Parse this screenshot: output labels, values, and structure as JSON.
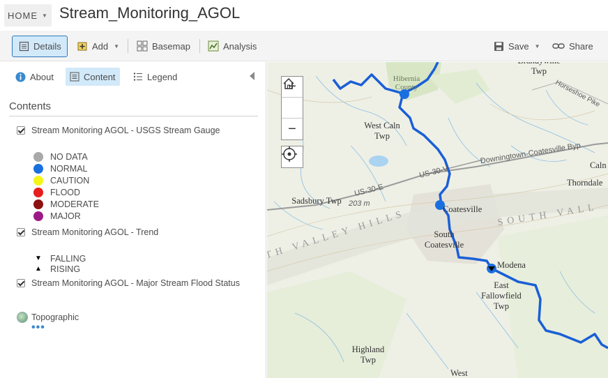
{
  "header": {
    "home_label": "HOME",
    "map_title": "Stream_Monitoring_AGOL"
  },
  "toolbar": {
    "details_label": "Details",
    "add_label": "Add",
    "basemap_label": "Basemap",
    "analysis_label": "Analysis",
    "save_label": "Save",
    "share_label": "Share"
  },
  "panel": {
    "tabs": [
      {
        "label": "About",
        "icon": "info-icon",
        "active": false
      },
      {
        "label": "Content",
        "icon": "content-icon",
        "active": true
      },
      {
        "label": "Legend",
        "icon": "legend-icon",
        "active": false
      }
    ],
    "contents_heading": "Contents",
    "layers": [
      {
        "label": "Stream Monitoring AGOL - USGS Stream Gauge",
        "checked": true
      },
      {
        "label": "Stream Monitoring AGOL - Trend",
        "checked": true
      },
      {
        "label": "Stream Monitoring AGOL - Major Stream Flood Status",
        "checked": true
      }
    ],
    "gauge_legend": [
      {
        "label": "NO DATA",
        "color": "#a9a9a9"
      },
      {
        "label": "NORMAL",
        "color": "#1a6fe0"
      },
      {
        "label": "CAUTION",
        "color": "#f5f51a"
      },
      {
        "label": "FLOOD",
        "color": "#e81d1d"
      },
      {
        "label": "MODERATE",
        "color": "#8c1212"
      },
      {
        "label": "MAJOR",
        "color": "#9c1a86"
      }
    ],
    "trend_legend": [
      {
        "label": "FALLING",
        "symbol": "▼"
      },
      {
        "label": "RISING",
        "symbol": "▲"
      }
    ],
    "basemap_label": "Topographic",
    "ellipsis": "•••"
  },
  "map": {
    "controls": {
      "zoom_in": "+",
      "zoom_out": "−"
    },
    "labels": {
      "hibernia": "Hibernia County",
      "brandywine": "Brandywine Twp",
      "west_caln": "West Caln Twp",
      "sadsbury": "Sadsbury Twp",
      "coatesville": "Coatesville",
      "south_coatesville": "South Coatesville",
      "modena": "Modena",
      "east_fallowfield": "East Fallowfield Twp",
      "highland": "Highland Twp",
      "west": "West",
      "caln": "Caln",
      "thorndale": "Thorndale",
      "elevation": "203 m",
      "us30v": "US-30-V",
      "us30e": "US-30-E",
      "downingtown": "Downingtown-Coatesville Byp",
      "horseshoe": "Horseshoe Pike",
      "valley_hills": "TH  VALLEY  HILLS",
      "south_valley": "SOUTH  VALL"
    },
    "colors": {
      "river": "#1a5fd6",
      "gauge": "#1a6fe0"
    }
  }
}
